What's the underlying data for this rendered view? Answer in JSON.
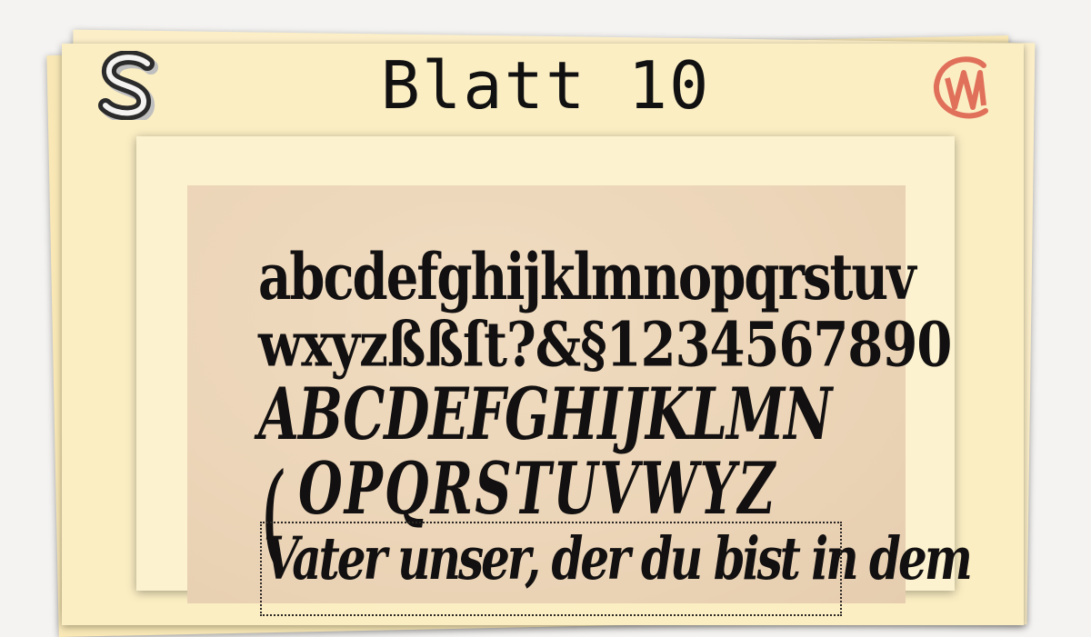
{
  "header": {
    "title": "Blatt 10",
    "logo_left": "S-monogram-icon",
    "logo_right": "CM-monogram-icon",
    "logo_right_color": "#e0705a"
  },
  "plate": {
    "line1": "abcdefghijklmnopqrstuv",
    "line2": "wxyzßßſt?&§1234567890",
    "line3": "ABCDEFGHIJKLMN",
    "line4": "OPQRSTUVWYZ",
    "line5": "Vater unser, der du bist in dem",
    "paper_color": "#ecd5b8",
    "ink_color": "#121010"
  },
  "colors": {
    "background": "#f4f3f1",
    "sheet": "#fbeec3",
    "frame": "#fcf2cf"
  }
}
